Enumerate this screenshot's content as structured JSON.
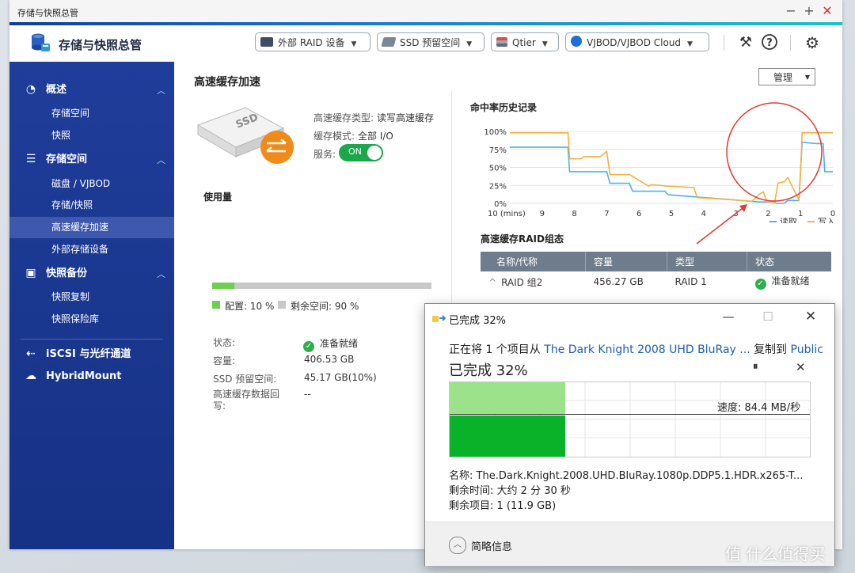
{
  "window": {
    "title": "存储与快照总管"
  },
  "header": {
    "app_title": "存储与快照总管",
    "buttons": [
      {
        "label": "外部 RAID 设备"
      },
      {
        "label": "SSD 预留空间"
      },
      {
        "label": "Qtier"
      },
      {
        "label": "VJBOD/VJBOD Cloud"
      }
    ]
  },
  "sidebar": {
    "sections": [
      {
        "label": "概述",
        "items": [
          "存储空间",
          "快照"
        ]
      },
      {
        "label": "存储空间",
        "items": [
          "磁盘 / VJBOD",
          "存储/快照",
          "高速缓存加速",
          "外部存储设备"
        ]
      },
      {
        "label": "快照备份",
        "items": [
          "快照复制",
          "快照保险库"
        ]
      },
      {
        "label": "iSCSI 与光纤通道",
        "items": []
      },
      {
        "label": "HybridMount",
        "items": []
      }
    ],
    "active_item": "高速缓存加速"
  },
  "main": {
    "title": "高速缓存加速",
    "manage_button": "管理",
    "ssd_badge": "SSD",
    "cache_info": {
      "type_label": "高速缓存类型:",
      "type_value": "读写高速缓存",
      "mode_label": "缓存模式:",
      "mode_value": "全部 I/O",
      "service_label": "服务:",
      "service_toggle": "ON"
    },
    "usage": {
      "title": "使用量",
      "used_percent": 10,
      "used_legend": "配置: 10 %",
      "free_legend": "剩余空间: 90 %"
    },
    "status_list": [
      {
        "label": "状态:",
        "value": "准备就绪"
      },
      {
        "label": "容量:",
        "value": "406.53 GB"
      },
      {
        "label": "SSD 预留空间:",
        "value": "45.17 GB(10%)"
      },
      {
        "label": "高速缓存数据回写:",
        "value": "--"
      }
    ],
    "hit_chart_title": "命中率历史记录",
    "raid_title": "高速缓存RAID组态",
    "raid_table": {
      "headers": [
        "名称/代称",
        "容量",
        "类型",
        "状态"
      ],
      "rows": [
        {
          "name": "RAID 组2",
          "capacity": "456.27 GB",
          "type": "RAID 1",
          "status": "准备就绪"
        }
      ]
    }
  },
  "chart_data": {
    "type": "line",
    "title": "命中率历史记录",
    "xlabel": "10 (mins)",
    "x_ticks": [
      "10 (mins)",
      "9",
      "8",
      "7",
      "6",
      "5",
      "4",
      "3",
      "2",
      "1",
      "0"
    ],
    "y_ticks": [
      "100%",
      "75%",
      "50%",
      "25%",
      "0%"
    ],
    "ylim": [
      0,
      100
    ],
    "xlim": [
      10,
      0
    ],
    "series": [
      {
        "name": "读取",
        "color": "#4ab3e8",
        "x": [
          10,
          8.2,
          8.15,
          7.0,
          6.9,
          6.3,
          6.2,
          5.2,
          5.1,
          3.1,
          2.3,
          1.8,
          1.75,
          1.5,
          1.4,
          1.05,
          0.95,
          0.75,
          0.5,
          0.3,
          0.25,
          0.0
        ],
        "y": [
          78,
          78,
          44,
          44,
          28,
          28,
          17,
          17,
          12,
          5,
          2,
          2,
          0,
          0,
          4,
          4,
          85,
          84,
          83,
          83,
          44,
          44
        ]
      },
      {
        "name": "写入",
        "color": "#f5b041",
        "x": [
          10,
          8.2,
          8.15,
          7.8,
          7.7,
          7.2,
          7.0,
          6.9,
          6.3,
          5.7,
          5.6,
          5.1,
          4.3,
          4.2,
          3.1,
          2.5,
          2.3,
          2.15,
          2.05,
          1.8,
          1.7,
          1.5,
          1.4,
          1.05,
          1.0,
          0.95,
          0.0
        ],
        "y": [
          98,
          98,
          62,
          62,
          65,
          65,
          72,
          40,
          40,
          24,
          26,
          24,
          22,
          8,
          5,
          3,
          12,
          16,
          3,
          1,
          28,
          30,
          36,
          5,
          40,
          98,
          98
        ]
      }
    ],
    "legend": "bottom-right",
    "grid": true
  },
  "copy_dialog": {
    "title": "已完成 32%",
    "summary_prefix": "正在将 1 个项目从",
    "source": "The Dark Knight 2008 UHD BluRay ...",
    "copy_to": "复制到",
    "dest": "Public",
    "progress_text": "已完成 32%",
    "progress_percent": 32,
    "speed": "速度: 84.4 MB/秒",
    "name_label": "名称:",
    "name_value": "The.Dark.Knight.2008.UHD.BluRay.1080p.DDP5.1.HDR.x265-T...",
    "time_label": "剩余时间:",
    "time_value": "大约 2 分 30 秒",
    "items_label": "剩余项目:",
    "items_value": "1 (11.9 GB)",
    "more_info": "简略信息"
  },
  "watermark": "值 什么值得买"
}
